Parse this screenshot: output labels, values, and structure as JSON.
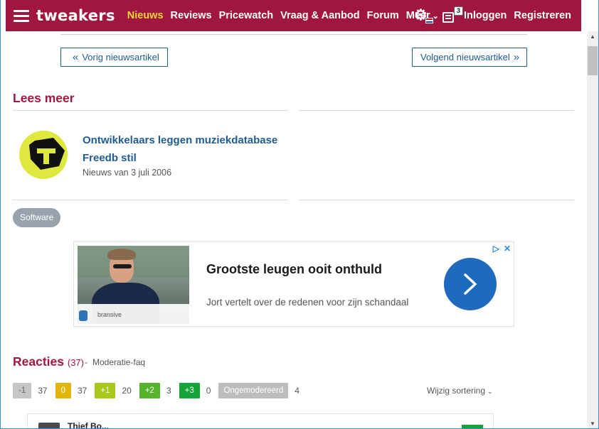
{
  "header": {
    "logo": "tweakers",
    "nav": [
      {
        "label": "Nieuws",
        "active": true
      },
      {
        "label": "Reviews",
        "active": false
      },
      {
        "label": "Pricewatch",
        "active": false
      },
      {
        "label": "Vraag & Aanbod",
        "active": false
      },
      {
        "label": "Forum",
        "active": false
      },
      {
        "label": "Meer",
        "active": false
      }
    ],
    "notification_count": "3",
    "login_label": "Inloggen",
    "register_label": "Registreren",
    "brand_color": "#a0163f",
    "active_color": "#f5d43a",
    "icons": [
      "menu-icon",
      "chevron-down-icon",
      "settings-gear-icon",
      "flag-nl-icon",
      "list-icon"
    ]
  },
  "article_nav": {
    "prev_label": "Vorig nieuwsartikel",
    "next_label": "Volgend nieuwsartikel"
  },
  "read_more": {
    "title": "Lees meer",
    "items": [
      {
        "title": "Ontwikkelaars leggen muziekdatabase Freedb stil",
        "meta": "Nieuws van 3 juli 2006"
      }
    ]
  },
  "tags": [
    "Software"
  ],
  "ad": {
    "brand": "bransive",
    "title": "Grootste leugen ooit onthuld",
    "subtitle": "Jort vertelt over de redenen voor zijn schandaal",
    "cta_color": "#1e6bbd"
  },
  "reactions": {
    "title": "Reacties",
    "count": "(37)",
    "separator": "-",
    "moderation_link": "Moderatie-faq",
    "filters": [
      {
        "label": "-1",
        "count": "37"
      },
      {
        "label": "0",
        "count": "37"
      },
      {
        "label": "+1",
        "count": "20"
      },
      {
        "label": "+2",
        "count": "3"
      },
      {
        "label": "+3",
        "count": "0"
      },
      {
        "label": "Ongemodereerd",
        "count": "4"
      }
    ],
    "sort_label": "Wijzig sortering",
    "first_comment_name": "Thief Bo..."
  }
}
